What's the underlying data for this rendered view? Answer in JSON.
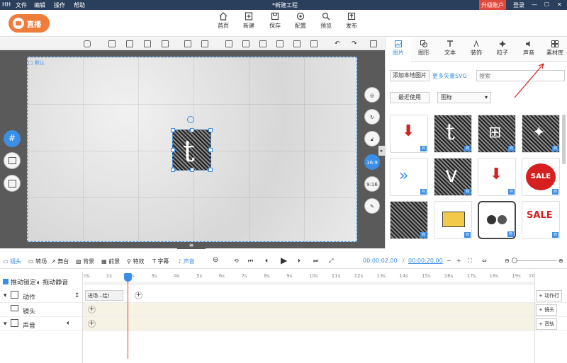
{
  "titlebar": {
    "logo": "HH",
    "menus": [
      "文件",
      "编辑",
      "操作",
      "帮助"
    ],
    "title": "*新建工程",
    "upgrade": "升级账户",
    "login": "登录"
  },
  "logo_text": "直播",
  "main_tools": [
    {
      "icon": "home-icon",
      "label": "首页"
    },
    {
      "icon": "new-file-icon",
      "label": "新建"
    },
    {
      "icon": "save-icon",
      "label": "保存"
    },
    {
      "icon": "config-icon",
      "label": "配置"
    },
    {
      "icon": "preview-icon",
      "label": "预览"
    },
    {
      "icon": "publish-icon",
      "label": "发布"
    }
  ],
  "stage_label": "默认",
  "right_tools": [
    {
      "label": "16:9"
    },
    {
      "label": "9:16"
    }
  ],
  "panel": {
    "tabs": [
      {
        "icon": "image-icon",
        "label": "图片"
      },
      {
        "icon": "shape-icon",
        "label": "图形"
      },
      {
        "icon": "text-icon",
        "label": "文本"
      },
      {
        "icon": "decor-icon",
        "label": "装饰"
      },
      {
        "icon": "particle-icon",
        "label": "粒子"
      },
      {
        "icon": "sound-icon",
        "label": "声音"
      },
      {
        "icon": "library-icon",
        "label": "素材库"
      }
    ],
    "add_local": "添加本地图片",
    "more_svg": "更多矢量SVG",
    "search_placeholder": "搜索",
    "recent": "最近使用",
    "category": "图标"
  },
  "timeline": {
    "tabs": [
      "镜头",
      "转场",
      "舞台",
      "背景",
      "前景",
      "特效",
      "字幕",
      "声音"
    ],
    "time_current": "00:00:02.00",
    "time_total": "00:00:20.00",
    "lock_label": "推动锁定",
    "mute_label": "拖动静音",
    "ruler": [
      "0s",
      "1s",
      "2s",
      "3s",
      "4s",
      "5s",
      "6s",
      "7s",
      "8s",
      "9s",
      "10s",
      "11s",
      "12s",
      "13s",
      "14s",
      "15s",
      "16s",
      "17s",
      "18s",
      "19s",
      "20"
    ],
    "tracks": [
      {
        "label": "动作",
        "add": "动作行"
      },
      {
        "label": "镜头",
        "add": "镜头"
      },
      {
        "label": "声音",
        "add": "音轨"
      }
    ],
    "clip": "进场...绘)"
  },
  "colors": {
    "accent": "#3b8ee6",
    "logo": "#ee7d3b",
    "titlebar": "#2a3f5c",
    "upgrade": "#e04a3c"
  }
}
